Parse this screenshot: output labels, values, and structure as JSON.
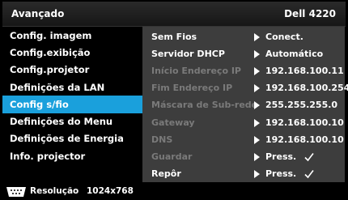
{
  "header": {
    "title": "Avançado",
    "model": "Dell 4220"
  },
  "menu": {
    "items": [
      {
        "label": "Config. imagem"
      },
      {
        "label": "Config.exibição"
      },
      {
        "label": "Config.projetor"
      },
      {
        "label": "Definições da LAN"
      },
      {
        "label": "Config s/fio"
      },
      {
        "label": "Definições do Menu"
      },
      {
        "label": "Definições de Energia"
      },
      {
        "label": "Info. projector"
      }
    ],
    "active_index": 4
  },
  "settings": {
    "rows": [
      {
        "label": "Sem Fios",
        "value": "Conect.",
        "enabled": true
      },
      {
        "label": "Servidor DHCP",
        "value": "Automático",
        "enabled": true
      },
      {
        "label": "Início Endereço IP",
        "value": "192.168.100.11",
        "enabled": false
      },
      {
        "label": "Fim Endereço IP",
        "value": "192.168.100.254",
        "enabled": false
      },
      {
        "label": "Máscara de Sub-rede",
        "value": "255.255.255.0",
        "enabled": false
      },
      {
        "label": "Gateway",
        "value": "192.168.100.10",
        "enabled": false
      },
      {
        "label": "DNS",
        "value": "192.168.100.10",
        "enabled": false
      },
      {
        "label": "Guardar",
        "value": "Press.",
        "enabled": false,
        "check": true
      },
      {
        "label": "Repôr",
        "value": "Press.",
        "enabled": true,
        "check": true
      }
    ]
  },
  "footer": {
    "label": "Resolução",
    "resolution": "1024x768",
    "icon": "vga-connector-icon"
  },
  "colors": {
    "accent": "#1aa0dc",
    "panel": "#3d3d3d",
    "disabled_text": "#7a7a7a"
  }
}
